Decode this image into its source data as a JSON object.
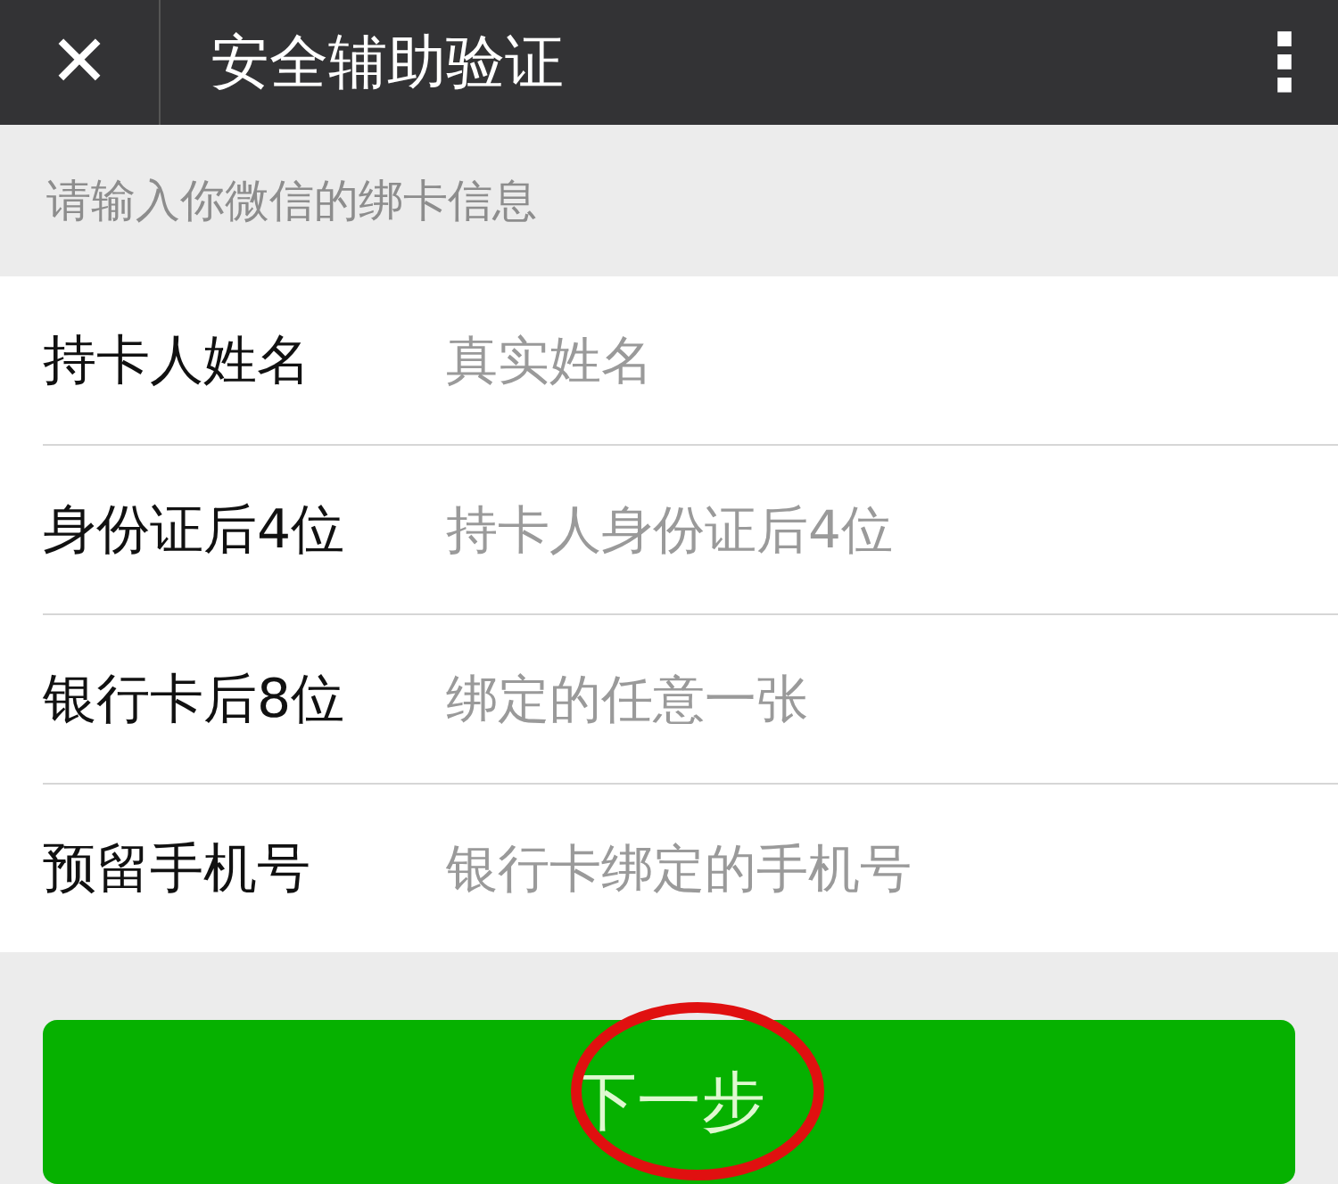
{
  "header": {
    "close": "✕",
    "title": "安全辅助验证",
    "more": "⋮"
  },
  "hint": "请输入你微信的绑卡信息",
  "fields": [
    {
      "label": "持卡人姓名",
      "placeholder": "真实姓名"
    },
    {
      "label": "身份证后4位",
      "placeholder": "持卡人身份证后4位"
    },
    {
      "label": "银行卡后8位",
      "placeholder": "绑定的任意一张"
    },
    {
      "label": "预留手机号",
      "placeholder": "银行卡绑定的手机号"
    }
  ],
  "next_button": {
    "label": "下一步",
    "annotated": true
  }
}
